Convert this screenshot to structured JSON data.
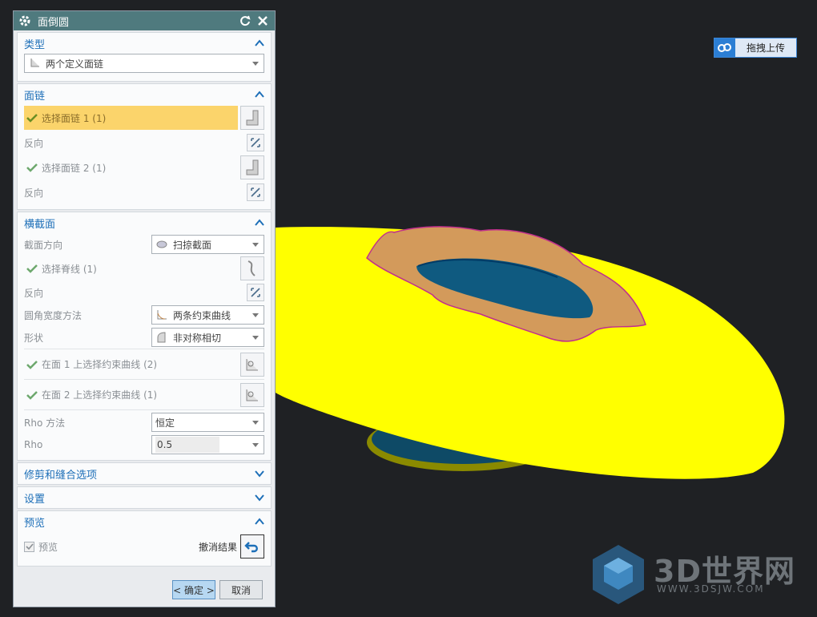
{
  "dialog": {
    "title": "面倒圆",
    "type_section": {
      "title": "类型",
      "type_value": "两个定义面链"
    },
    "face_chain_section": {
      "title": "面链",
      "select_chain_1": "选择面链 1 (1)",
      "reverse_1": "反向",
      "select_chain_2": "选择面链 2 (1)",
      "reverse_2": "反向"
    },
    "cross_section": {
      "title": "横截面",
      "orientation_label": "截面方向",
      "orientation_value": "扫掠截面",
      "select_spine": "选择脊线 (1)",
      "reverse": "反向",
      "width_method_label": "圆角宽度方法",
      "width_method_value": "两条约束曲线",
      "shape_label": "形状",
      "shape_value": "非对称相切",
      "constraint_face1": "在面 1 上选择约束曲线 (2)",
      "constraint_face2": "在面 2 上选择约束曲线 (1)",
      "rho_method_label": "Rho 方法",
      "rho_method_value": "恒定",
      "rho_label": "Rho",
      "rho_value": "0.5"
    },
    "trim_section": {
      "title": "修剪和缝合选项"
    },
    "settings_section": {
      "title": "设置"
    },
    "preview_section": {
      "title": "预览",
      "preview_label": "预览",
      "preview_checked": true,
      "undo_result_label": "撤消结果"
    },
    "ok_label": "< 确定 >",
    "cancel_label": "取消"
  },
  "upload_badge": {
    "label": "拖拽上传"
  },
  "watermark": {
    "brand": "3D世界网",
    "url": "WWW.3DSJW.COM"
  },
  "colors": {
    "title_bar": "#4f7a7e",
    "section_title": "#1d6fb8",
    "active_selection": "#fbd46b",
    "model_yellow": "#ffff00",
    "model_orange": "#d39a5b",
    "model_blue": "#0f5a80",
    "background": "#1f2124"
  }
}
